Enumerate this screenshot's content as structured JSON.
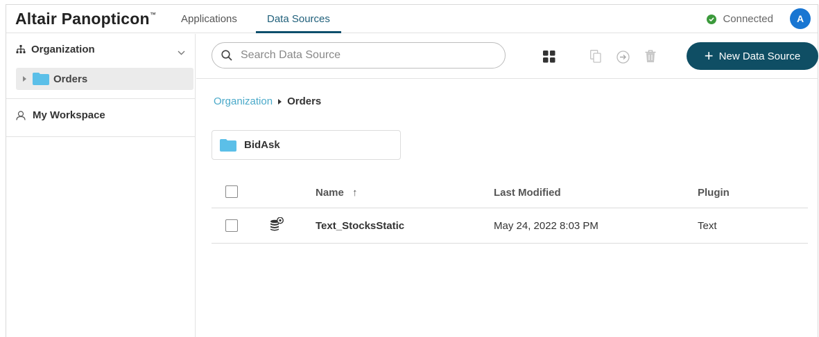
{
  "app": {
    "logo": "Altair Panopticon",
    "logo_mark": "™",
    "tabs": [
      {
        "label": "Applications"
      },
      {
        "label": "Data Sources"
      }
    ],
    "status": "Connected",
    "avatar_letter": "A",
    "colors": {
      "accent": "#0f4e64",
      "link": "#4aa9c9",
      "status_ok": "#3c9a3c",
      "avatar": "#1976d2",
      "folder": "#5bbfe8"
    }
  },
  "sidebar": {
    "organization_label": "Organization",
    "folders": [
      {
        "label": "Orders",
        "icon": "folder-icon"
      }
    ],
    "workspace_label": "My Workspace"
  },
  "toolbar": {
    "search_placeholder": "Search Data Source",
    "new_button_label": "New Data Source",
    "icons": [
      "grid-view-icon",
      "copy-icon",
      "move-icon",
      "trash-icon"
    ]
  },
  "breadcrumb": {
    "root": "Organization",
    "separator": "▸",
    "current": "Orders"
  },
  "folders": [
    {
      "label": "BidAsk"
    }
  ],
  "table": {
    "headers": {
      "name": "Name",
      "name_sort": "↑",
      "modified": "Last Modified",
      "plugin": "Plugin"
    },
    "rows": [
      {
        "name": "Text_StocksStatic",
        "modified": "May 24, 2022 8:03 PM",
        "plugin": "Text",
        "icon": "data-source-icon"
      }
    ]
  }
}
